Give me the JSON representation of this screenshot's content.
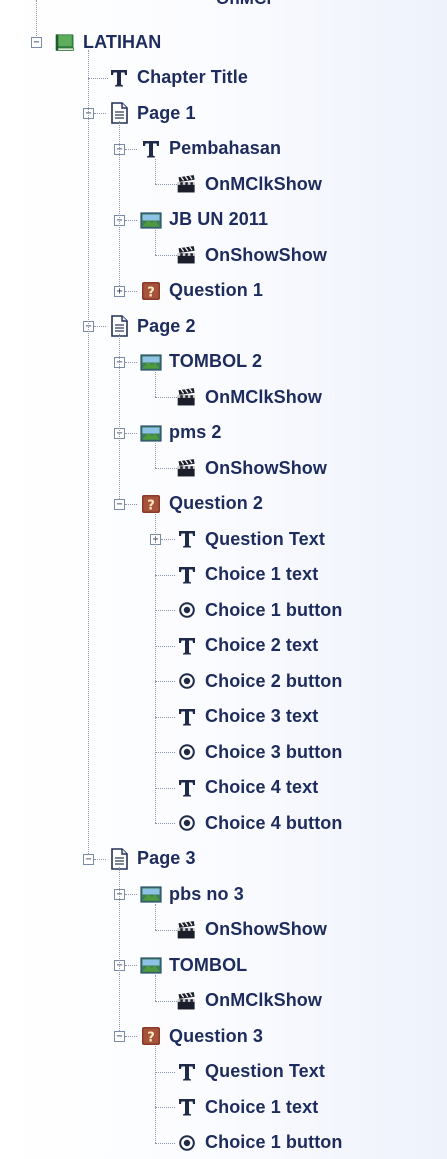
{
  "tree": {
    "top_partial_label": "OnMClkShow",
    "book": {
      "label": "LATIHAN",
      "icon": "book-icon"
    },
    "chapter_title": {
      "label": "Chapter Title",
      "icon": "text-t-icon"
    },
    "pages": [
      {
        "label": "Page 1",
        "items": [
          {
            "label": "Pembahasan",
            "icon": "text-t-icon",
            "action": "OnMClkShow"
          },
          {
            "label": "JB UN 2011",
            "icon": "image-icon",
            "action": "OnShowShow"
          },
          {
            "label": "Question 1",
            "icon": "question-icon",
            "collapsed": true
          }
        ]
      },
      {
        "label": "Page 2",
        "items": [
          {
            "label": "TOMBOL 2",
            "icon": "image-icon",
            "action": "OnMClkShow"
          },
          {
            "label": "pms 2",
            "icon": "image-icon",
            "action": "OnShowShow"
          },
          {
            "label": "Question 2",
            "icon": "question-icon",
            "children": [
              {
                "label": "Question Text",
                "icon": "text-t-icon",
                "collapsed": true
              },
              {
                "label": "Choice 1 text",
                "icon": "text-t-icon"
              },
              {
                "label": "Choice 1 button",
                "icon": "radio-icon"
              },
              {
                "label": "Choice 2 text",
                "icon": "text-t-icon"
              },
              {
                "label": "Choice 2 button",
                "icon": "radio-icon"
              },
              {
                "label": "Choice 3 text",
                "icon": "text-t-icon"
              },
              {
                "label": "Choice 3 button",
                "icon": "radio-icon"
              },
              {
                "label": "Choice 4 text",
                "icon": "text-t-icon"
              },
              {
                "label": "Choice 4 button",
                "icon": "radio-icon"
              }
            ]
          }
        ]
      },
      {
        "label": "Page 3",
        "items": [
          {
            "label": "pbs no 3",
            "icon": "image-icon",
            "action": "OnShowShow"
          },
          {
            "label": "TOMBOL",
            "icon": "image-icon",
            "action": "OnMClkShow"
          },
          {
            "label": "Question 3",
            "icon": "question-icon",
            "children": [
              {
                "label": "Question Text",
                "icon": "text-t-icon"
              },
              {
                "label": "Choice 1 text",
                "icon": "text-t-icon"
              },
              {
                "label": "Choice 1 button",
                "icon": "radio-icon"
              }
            ]
          }
        ]
      }
    ]
  }
}
